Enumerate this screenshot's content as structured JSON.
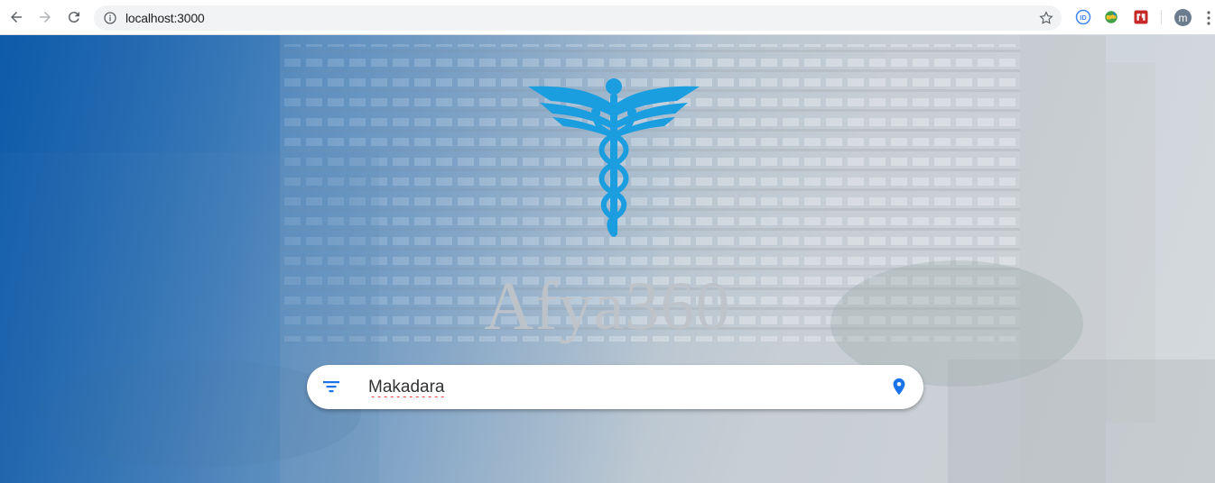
{
  "browser": {
    "url": "localhost:3000",
    "profile_initial": "m",
    "icons": [
      "back-arrow-icon",
      "forward-arrow-icon",
      "reload-icon",
      "info-icon",
      "bookmark-star-icon",
      "more-vert-icon"
    ],
    "extensions": [
      "extension-id-icon",
      "extension-earth-icon",
      "extension-red-icon"
    ]
  },
  "hero": {
    "brand_title": "Afya360",
    "logo_icon": "caduceus-icon",
    "accent_color": "#1a9ee0"
  },
  "search": {
    "value": "Makadara",
    "filter_icon": "filter-icon",
    "location_icon": "location-pin-icon",
    "accent_color": "#1a73e8"
  }
}
